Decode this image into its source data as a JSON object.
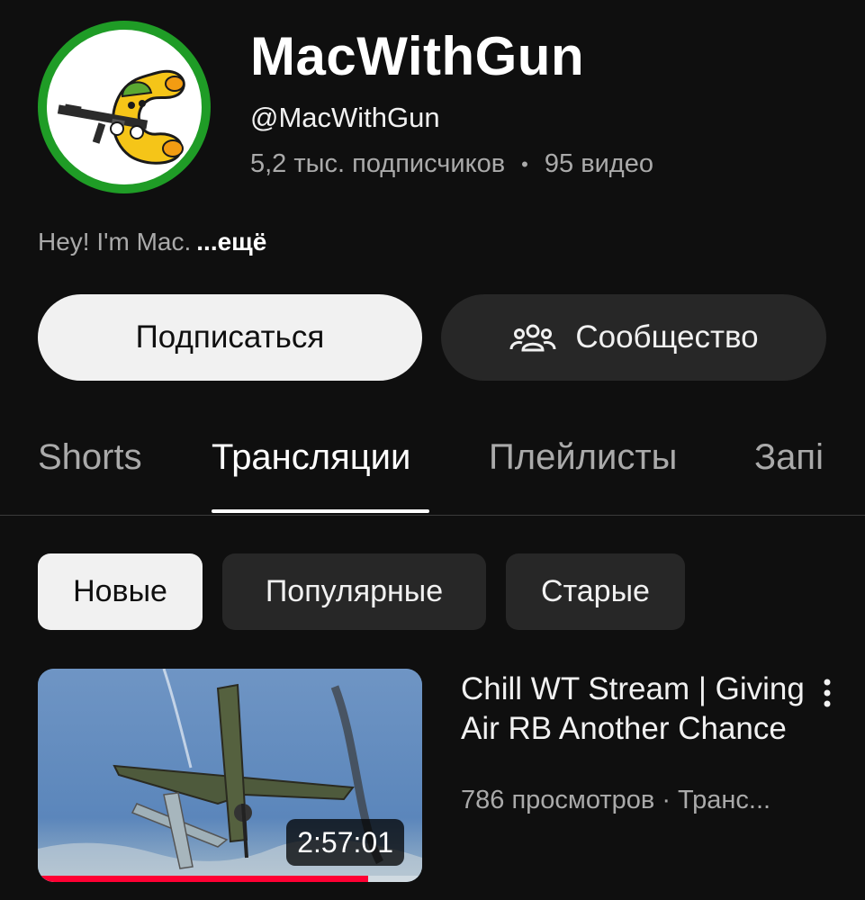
{
  "channel": {
    "name": "MacWithGun",
    "handle": "@MacWithGun",
    "subscribers": "5,2 тыс. подписчиков",
    "separator": "•",
    "videos": "95 видео",
    "description": "Hey! I'm Mac.",
    "more_label": "...ещё",
    "avatar_ring_color": "#1f9c26"
  },
  "actions": {
    "subscribe_label": "Подписаться",
    "community_label": "Сообщество",
    "community_icon": "people-group-icon"
  },
  "tabs": [
    {
      "label": "Shorts",
      "active": false
    },
    {
      "label": "Трансляции",
      "active": true
    },
    {
      "label": "Плейлисты",
      "active": false
    },
    {
      "label": "Запі",
      "active": false
    }
  ],
  "filters": [
    {
      "label": "Новые",
      "active": true
    },
    {
      "label": "Популярные",
      "active": false
    },
    {
      "label": "Старые",
      "active": false
    }
  ],
  "video": {
    "title": "Chill WT Stream | Giving Air RB Another Chance",
    "meta": "786 просмотров · Транс...",
    "duration": "2:57:01",
    "watch_progress": 0.86,
    "progress_color": "#ff0033",
    "menu_icon": "more-vertical-icon"
  }
}
